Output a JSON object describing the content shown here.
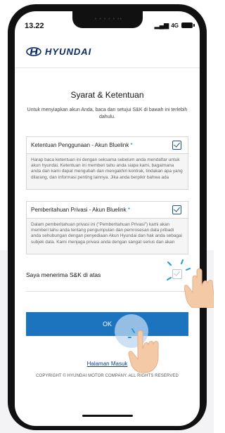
{
  "status_bar": {
    "time": "13.22",
    "network": "4G",
    "notch_dots": "• • • • •  ••"
  },
  "brand": {
    "logo_text": "HYUNDAI"
  },
  "page": {
    "title": "Syarat & Ketentuan",
    "subtitle": "Untuk menyiapkan akun Anda, baca dan setujui S&K di bawah ini terlebih dahulu."
  },
  "sections": [
    {
      "title": "Ketentuan Penggunaan - Akun Bluelink",
      "required_mark": "*",
      "checked": true,
      "body": "Harap baca ketentuan ini dengan seksama sebelum anda mendaftar untuk akun hyundai. Ketentuan ini memberi tahu anda siapa kami, bagaimana anda dan kami dapat mengubah dan mengakhiri kontrak, tindakan apa yang dilarang, dan informasi penting lainnya. Jika anda berpikir bahwa ada"
    },
    {
      "title": "Pemberitahuan Privasi - Akun Bluelink",
      "required_mark": "*",
      "checked": true,
      "body": "Dalam pemberitahuan privasi ini (\"Pemberitahuan Privasi\") kami akan memberi tahu anda tentang pengumpulan dan pemrosesan data pribadi anda sehubungan dengan penyediaan Akun Hyundai dan hak anda sebagai subjek data. Kami menjaga privasi anda dengan sangat serius dan akan"
    }
  ],
  "accept_all": {
    "label": "Saya menerima S&K di atas",
    "checked": false
  },
  "buttons": {
    "ok": "OK"
  },
  "links": {
    "login": "Halaman Masuk"
  },
  "footer": {
    "copyright": "COPYRIGHT © HYUNDAI MOTOR COMPANY. ALL RIGHTS RESERVED"
  },
  "colors": {
    "accent": "#1c73be",
    "checkbox": "#1c4f9c",
    "brand_navy": "#0a2a66",
    "hand_skin": "#f3c9a6"
  },
  "icons": [
    "hyundai-logo-icon",
    "signal-icon",
    "battery-icon",
    "checkmark-icon",
    "tap-hand-icon"
  ]
}
